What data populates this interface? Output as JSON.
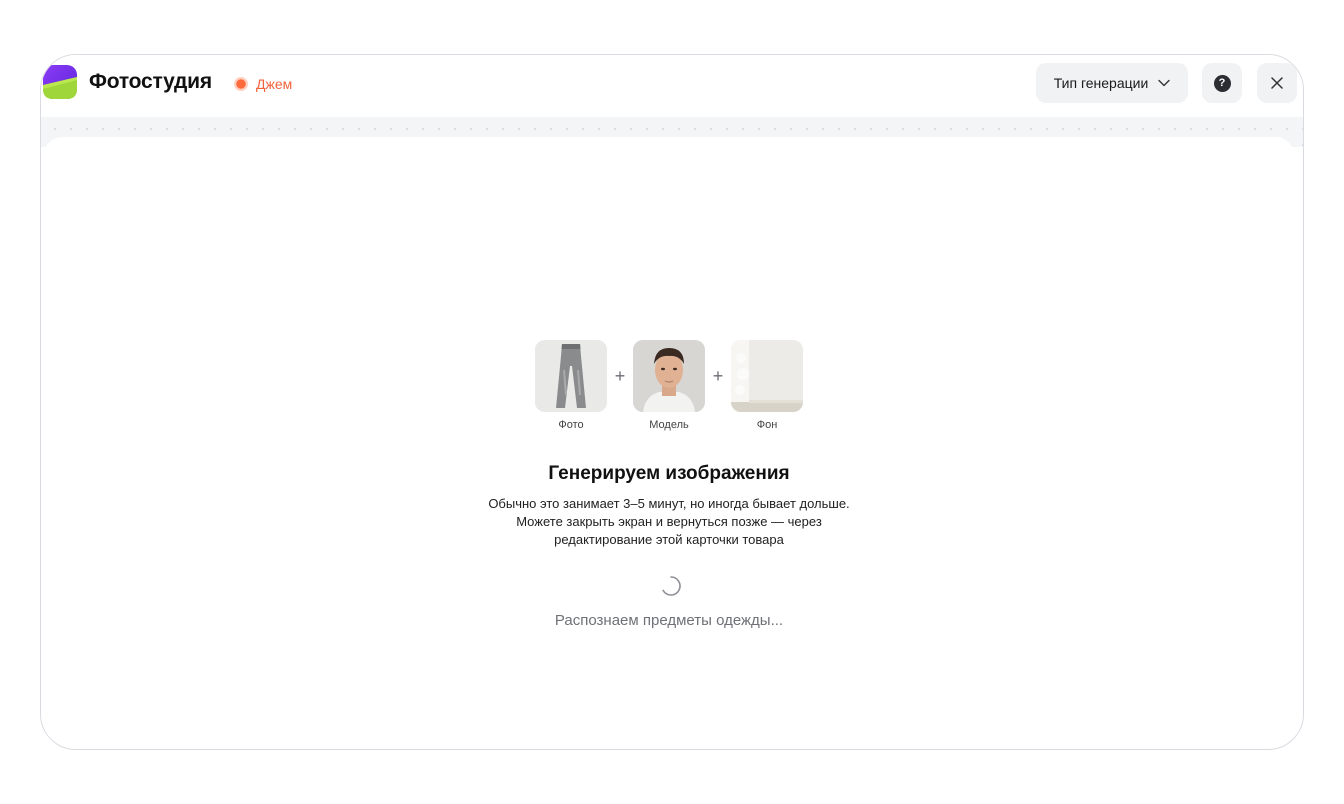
{
  "header": {
    "app_title": "Фотостудия",
    "badge_label": "Джем",
    "badge_color": "#f0643c",
    "generation_type_label": "Тип генерации",
    "icons": [
      "app-logo-icon",
      "chevron-down-icon",
      "help-icon",
      "close-icon"
    ]
  },
  "inputs": {
    "tiles": [
      {
        "caption": "Фото",
        "image": "jeans-photo"
      },
      {
        "caption": "Модель",
        "image": "male-model-portrait"
      },
      {
        "caption": "Фон",
        "image": "light-interior-background"
      }
    ],
    "separator": "+"
  },
  "progress": {
    "heading": "Генерируем изображения",
    "description_lines": [
      "Обычно это занимает 3–5 минут, но иногда бывает дольше.",
      "Можете закрыть экран и вернуться позже — через",
      "редактирование этой карточки товара"
    ],
    "status_text": "Распознаем предметы одежды..."
  }
}
